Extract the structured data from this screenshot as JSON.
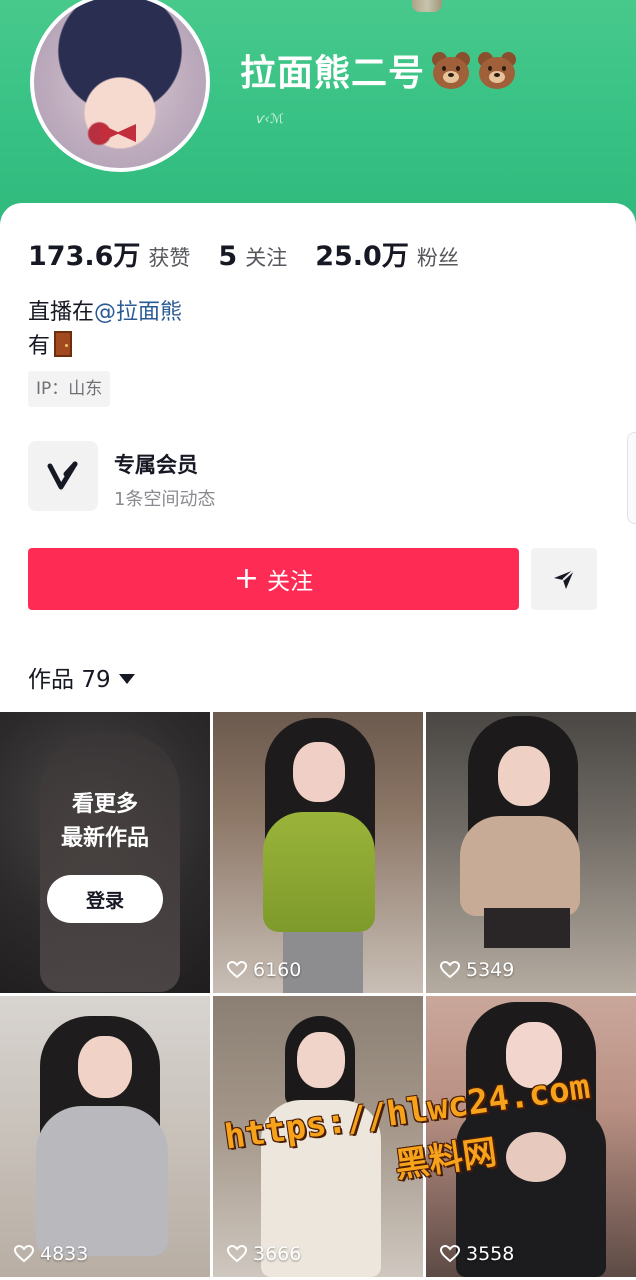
{
  "profile": {
    "nickname": "拉面熊二号",
    "subtitle": "ѵ‹ℳ",
    "nickname_icons": [
      "bear-face-icon",
      "bear-face-icon"
    ]
  },
  "stats": [
    {
      "value": "173.6万",
      "label": "获赞"
    },
    {
      "value": "5",
      "label": "关注"
    },
    {
      "value": "25.0万",
      "label": "粉丝"
    }
  ],
  "bio": {
    "line1_prefix": "直播在",
    "line1_mention": "@拉面熊",
    "line2_text": "有",
    "line2_icon": "door-icon"
  },
  "ip_tag": "IP：山东",
  "member": {
    "title": "专属会员",
    "subtitle": "1条空间动态"
  },
  "actions": {
    "follow_plus": "+",
    "follow_label": "关注",
    "share_icon": "send-arrow-icon"
  },
  "works": {
    "label": "作品",
    "count": "79"
  },
  "locked_tile": {
    "line1": "看更多",
    "line2": "最新作品",
    "login_label": "登录"
  },
  "videos": [
    {
      "likes": "6160"
    },
    {
      "likes": "5349"
    },
    {
      "likes": "4833"
    },
    {
      "likes": "3666"
    },
    {
      "likes": "3558"
    }
  ],
  "watermark": {
    "url": "https://hlwc24.com",
    "brand": "黑料网"
  },
  "colors": {
    "header_green": "#37c184",
    "follow_red": "#fe2c55",
    "mention_blue": "#2a5a96",
    "watermark_orange": "#f7a21b"
  }
}
